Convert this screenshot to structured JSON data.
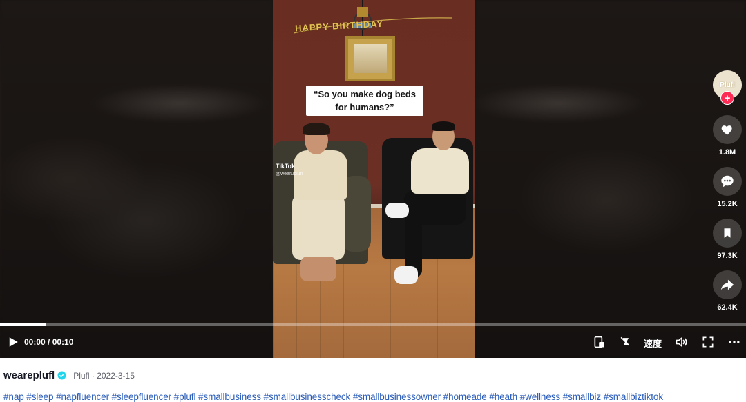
{
  "video": {
    "caption": "“So you make dog beds for humans?”",
    "banner_text": "HAPPY BIRTHDAY",
    "watermark": "TikTok",
    "watermark_handle": "@wearuplufl"
  },
  "actions": {
    "avatar_text": "Plufl",
    "follow": "+",
    "likes": "1.8M",
    "comments": "15.2K",
    "saves": "97.3K",
    "shares": "62.4K"
  },
  "player": {
    "time": "00:00 / 00:10",
    "progress": 0.062,
    "speed_label": "速度"
  },
  "post": {
    "username": "weareplufl",
    "verified": true,
    "meta": "Plufl · 2022-3-15",
    "hashtags": "#nap #sleep #napfluencer #sleepfluencer #plufl #smallbusiness #smallbusinesscheck #smallbusinessowner #homeade #heath #wellness #smallbiz #smallbiztiktok"
  },
  "colors": {
    "accent": "#fe2c55",
    "hashtag": "#2b5db9",
    "verified": "#20d5ec"
  },
  "icons": [
    "heart-icon",
    "comment-icon",
    "bookmark-icon",
    "share-icon",
    "play-icon",
    "pip-icon",
    "fullscreen-icon",
    "volume-icon",
    "more-icon",
    "verified-icon",
    "no-caption-icon"
  ]
}
